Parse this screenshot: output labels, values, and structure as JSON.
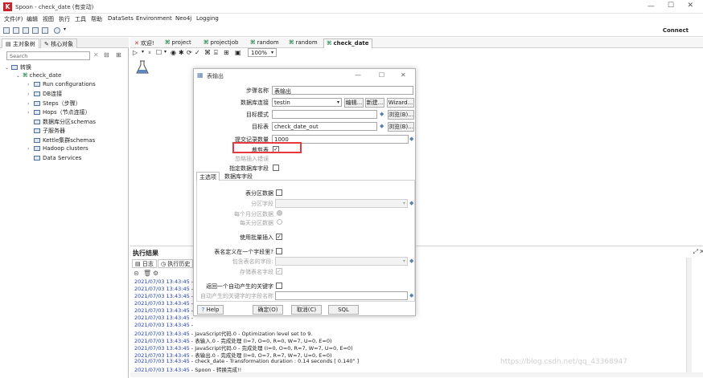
{
  "window": {
    "title": "Spoon - check_date (有变动)",
    "logo_letter": "K"
  },
  "menubar": [
    "文件(F)",
    "编辑",
    "视图",
    "执行",
    "工具",
    "帮助",
    "DataSets",
    "Environment",
    "Neo4j",
    "Logging"
  ],
  "toolbar": {
    "connect_label": "Connect"
  },
  "left_panel": {
    "tabs": [
      "主对象树",
      "核心对象"
    ],
    "search_placeholder": "Search",
    "tree": {
      "root": "转换",
      "child": "check_date",
      "items": [
        "Run configurations",
        "DB连接",
        "Steps（步骤）",
        "Hops（节点连接）",
        "数据库分区schemas",
        "子服务器",
        "Kettle集群schemas",
        "Hadoop clusters",
        "Data Services"
      ]
    }
  },
  "canvas_tabs": [
    "欢迎!",
    "project",
    "projectjob",
    "random",
    "random",
    "check_date"
  ],
  "canvas_toolbar": {
    "zoom": "100%"
  },
  "dialog": {
    "title": "表输出",
    "step_name_label": "步骤名称",
    "step_name_value": "表输出",
    "db_conn_label": "数据库连接",
    "db_conn_value": "testin",
    "btn_edit": "编辑...",
    "btn_new": "新建...",
    "btn_wizard": "Wizard...",
    "target_schema_label": "目标模式",
    "target_schema_value": "",
    "btn_browse1": "浏览(B)...",
    "target_table_label": "目标表",
    "target_table_value": "check_date_out",
    "btn_browse2": "浏览(B)...",
    "commit_label": "提交记录数量",
    "commit_value": "1000",
    "truncate_label": "裁剪表",
    "truncate_checked": "✓",
    "ignore_label": "忽略插入错误",
    "specify_fields_label": "指定数据库字段",
    "inner_tabs": [
      "主选项",
      "数据库字段"
    ],
    "partition_label": "表分区数据",
    "partition_field_label": "分区字段",
    "per_month_label": "每个月分区数据",
    "per_day_label": "每天分区数据",
    "batch_label": "使用批量插入",
    "batch_checked": "✓",
    "tablename_in_field_label": "表名定义在一个字段里?",
    "tablename_field_label": "包含表名的字段:",
    "store_tablename_label": "存储表名字段",
    "store_tablename_checked": "✓",
    "return_key_label": "返回一个自动产生的关键字",
    "auto_key_field_label": "自动产生的关键字的字段名称",
    "btn_help": "Help",
    "btn_ok": "确定(O)",
    "btn_cancel": "取消(C)",
    "btn_sql": "SQL"
  },
  "exec": {
    "title": "执行结果",
    "tabs": [
      "日志",
      "执行历史"
    ],
    "lines": [
      {
        "ts": "2021/07/03 13:43:45",
        "msg": " - "
      },
      {
        "ts": "2021/07/03 13:43:45",
        "msg": " - "
      },
      {
        "ts": "2021/07/03 13:43:45",
        "msg": " - "
      },
      {
        "ts": "2021/07/03 13:43:45",
        "msg": " - "
      },
      {
        "ts": "2021/07/03 13:43:45",
        "msg": " - "
      },
      {
        "ts": "2021/07/03 13:43:45",
        "msg": " - "
      },
      {
        "ts": "2021/07/03 13:43:45",
        "msg": " - "
      },
      {
        "ts": "2021/07/03 13:43:45",
        "msg": " - JavaScript代码.0 - Optimization level set to 9."
      },
      {
        "ts": "2021/07/03 13:43:45",
        "msg": " - 表输入.0 - 完成处理 (I=7, O=0, R=0, W=7, U=0, E=0)"
      },
      {
        "ts": "2021/07/03 13:43:45",
        "msg": " - JavaScript代码.0 - 完成处理 (I=0, O=0, R=7, W=7, U=0, E=0)"
      },
      {
        "ts": "2021/07/03 13:43:45",
        "msg": " - 表输出.0 - 完成处理 (I=0, O=7, R=7, W=7, U=0, E=0)"
      },
      {
        "ts": "2021/07/03 13:43:45",
        "msg": " - check_date - Transformation duration : 0.14 seconds [  0.140\" ]"
      },
      {
        "ts": "2021/07/03 13:43:45",
        "msg": " - Spoon - 转换完成!!"
      }
    ]
  },
  "watermark": "https://blog.csdn.net/qq_43368947",
  "colors": {
    "accent_red": "#e8373d",
    "timestamp_blue": "#1f3fb0"
  }
}
